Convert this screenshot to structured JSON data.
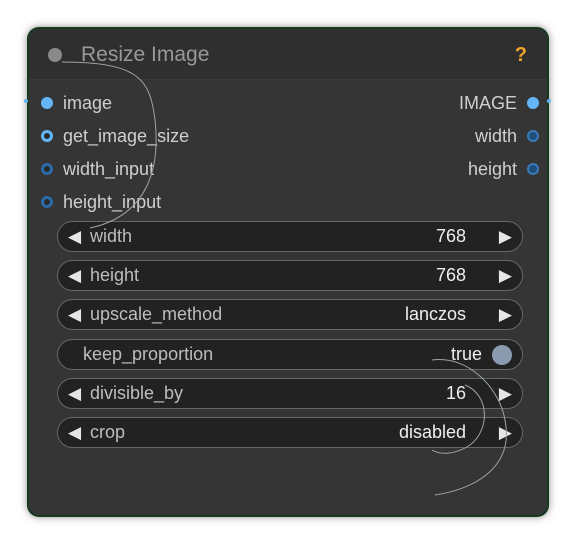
{
  "node": {
    "title": "Resize Image",
    "help_label": "?"
  },
  "inputs": [
    {
      "label": "image"
    },
    {
      "label": "get_image_size"
    },
    {
      "label": "width_input"
    },
    {
      "label": "height_input"
    }
  ],
  "outputs": [
    {
      "label": "IMAGE"
    },
    {
      "label": "width"
    },
    {
      "label": "height"
    }
  ],
  "widgets": {
    "width": {
      "label": "width",
      "value": "768"
    },
    "height": {
      "label": "height",
      "value": "768"
    },
    "upscale_method": {
      "label": "upscale_method",
      "value": "lanczos"
    },
    "keep_proportion": {
      "label": "keep_proportion",
      "value": "true"
    },
    "divisible_by": {
      "label": "divisible_by",
      "value": "16"
    },
    "crop": {
      "label": "crop",
      "value": "disabled"
    }
  },
  "glyphs": {
    "left": "◀",
    "right": "▶"
  },
  "colors": {
    "node_bg": "#353535",
    "node_border": "#173a1d",
    "slot_blue": "#64b5f6",
    "help_orange": "#f0a32b",
    "widget_bg": "#222222"
  }
}
